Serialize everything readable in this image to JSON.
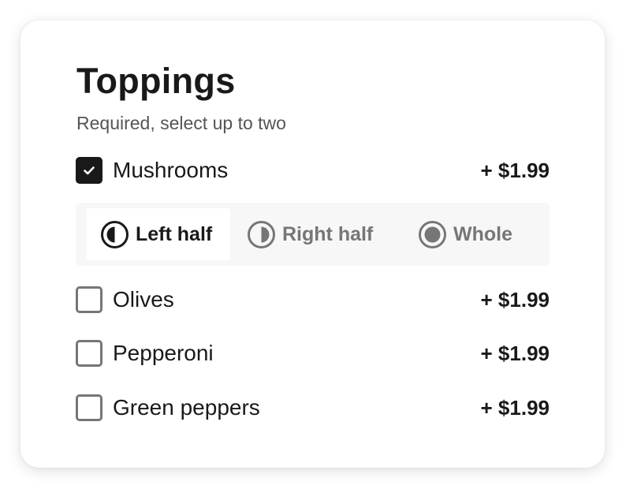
{
  "section": {
    "title": "Toppings",
    "subtitle": "Required, select up to two"
  },
  "options": [
    {
      "label": "Mushrooms",
      "price": "+ $1.99",
      "checked": true
    },
    {
      "label": "Olives",
      "price": "+ $1.99",
      "checked": false
    },
    {
      "label": "Pepperoni",
      "price": "+ $1.99",
      "checked": false
    },
    {
      "label": "Green peppers",
      "price": "+ $1.99",
      "checked": false
    }
  ],
  "placement": {
    "selected": "Left half",
    "choices": [
      {
        "label": "Left half",
        "icon": "left-half-circle-icon"
      },
      {
        "label": "Right half",
        "icon": "right-half-circle-icon"
      },
      {
        "label": "Whole",
        "icon": "whole-circle-icon"
      }
    ]
  },
  "colors": {
    "text": "#191919",
    "muted": "#767676",
    "segment_bg": "#f7f7f7"
  }
}
